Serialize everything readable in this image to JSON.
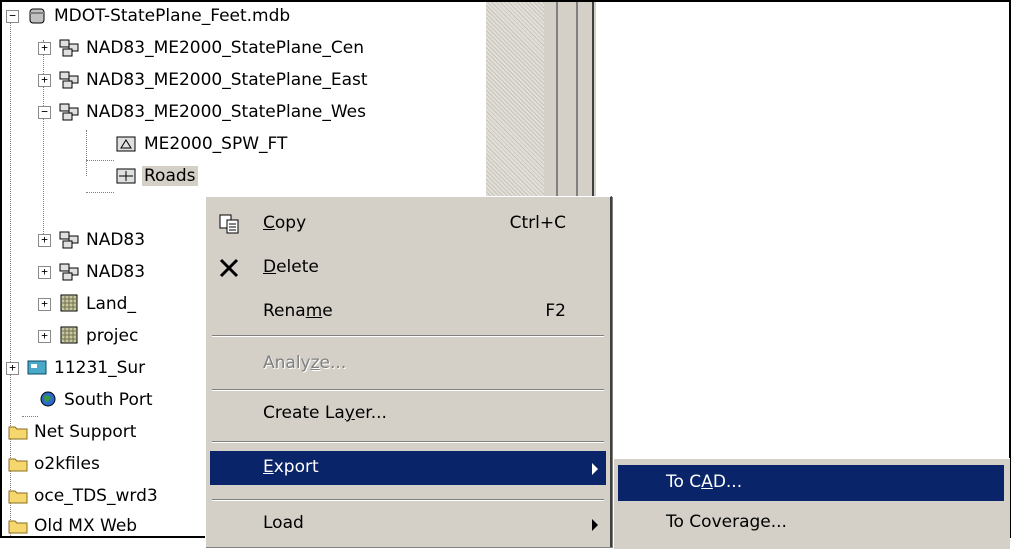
{
  "tree": {
    "items": [
      {
        "label": "MDOT-StatePlane_Feet.mdb",
        "icon": "database-icon",
        "expander": "−"
      },
      {
        "label": "NAD83_ME2000_StatePlane_Cen",
        "icon": "feature-dataset-icon",
        "expander": "+"
      },
      {
        "label": "NAD83_ME2000_StatePlane_East",
        "icon": "feature-dataset-icon",
        "expander": "+"
      },
      {
        "label": "NAD83_ME2000_StatePlane_Wes",
        "icon": "feature-dataset-icon",
        "expander": "−"
      },
      {
        "label": "ME2000_SPW_FT",
        "icon": "annotation-class-icon"
      },
      {
        "label": "Roads",
        "icon": "line-feature-class-icon"
      },
      {
        "label": "NAD83",
        "icon": "feature-dataset-icon",
        "expander": "+"
      },
      {
        "label": "NAD83",
        "icon": "feature-dataset-icon",
        "expander": "+"
      },
      {
        "label": "Land_",
        "icon": "raster-icon",
        "expander": "+"
      },
      {
        "label": "projec",
        "icon": "raster-icon",
        "expander": "+"
      },
      {
        "label": "11231_Sur",
        "icon": "toolbox-icon",
        "expander": "+"
      },
      {
        "label": "South Port",
        "icon": "globe-icon"
      },
      {
        "label": "Net Support",
        "icon": "folder-icon"
      },
      {
        "label": "o2kfiles",
        "icon": "folder-icon"
      },
      {
        "label": "oce_TDS_wrd3",
        "icon": "folder-icon"
      },
      {
        "label": "Old MX Web",
        "icon": "folder-icon"
      }
    ]
  },
  "context_menu": {
    "copy": {
      "label_pre": "",
      "label_u": "C",
      "label_post": "opy",
      "shortcut": "Ctrl+C",
      "icon": "copy-icon"
    },
    "delete": {
      "label_pre": "",
      "label_u": "D",
      "label_post": "elete",
      "icon": "delete-icon"
    },
    "rename": {
      "label_pre": "Rena",
      "label_u": "m",
      "label_post": "e",
      "shortcut": "F2"
    },
    "analyze": {
      "label_pre": "Analy",
      "label_u": "z",
      "label_post": "e...",
      "disabled": true
    },
    "create_layer": {
      "label_pre": "Create La",
      "label_u": "y",
      "label_post": "er..."
    },
    "export": {
      "label_pre": "",
      "label_u": "E",
      "label_post": "xport"
    },
    "load": {
      "label_pre": "Load",
      "label_u": "",
      "label_post": ""
    }
  },
  "submenu": {
    "to_cad": {
      "label_pre": "To C",
      "label_u": "A",
      "label_post": "D..."
    },
    "to_coverage": {
      "label_pre": "To Coverage...",
      "label_u": "",
      "label_post": ""
    }
  },
  "colors": {
    "highlight": "#0a246a",
    "menu_bg": "#d4d0c8"
  }
}
